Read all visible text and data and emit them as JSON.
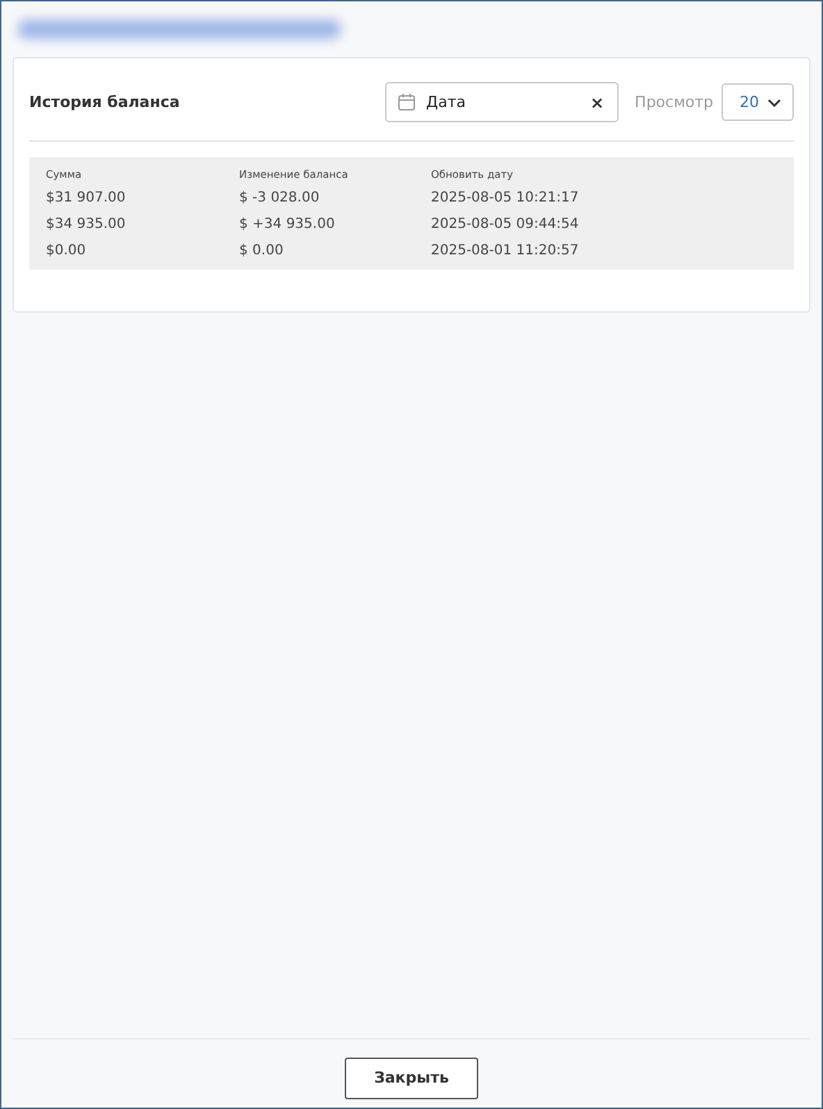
{
  "card": {
    "title": "История баланса",
    "date_filter": {
      "label": "Дата",
      "clear": "×"
    },
    "view": {
      "label": "Просмотр",
      "value": "20"
    }
  },
  "table": {
    "columns": [
      "Сумма",
      "Изменение баланса",
      "Обновить дату"
    ],
    "rows": [
      [
        "$31 907.00",
        "$ -3 028.00",
        "2025-08-05 10:21:17"
      ],
      [
        "$34 935.00",
        "$ +34 935.00",
        "2025-08-05 09:44:54"
      ],
      [
        "$0.00",
        "$ 0.00",
        "2025-08-01 11:20:57"
      ]
    ]
  },
  "footer": {
    "button": "Закрыть"
  }
}
